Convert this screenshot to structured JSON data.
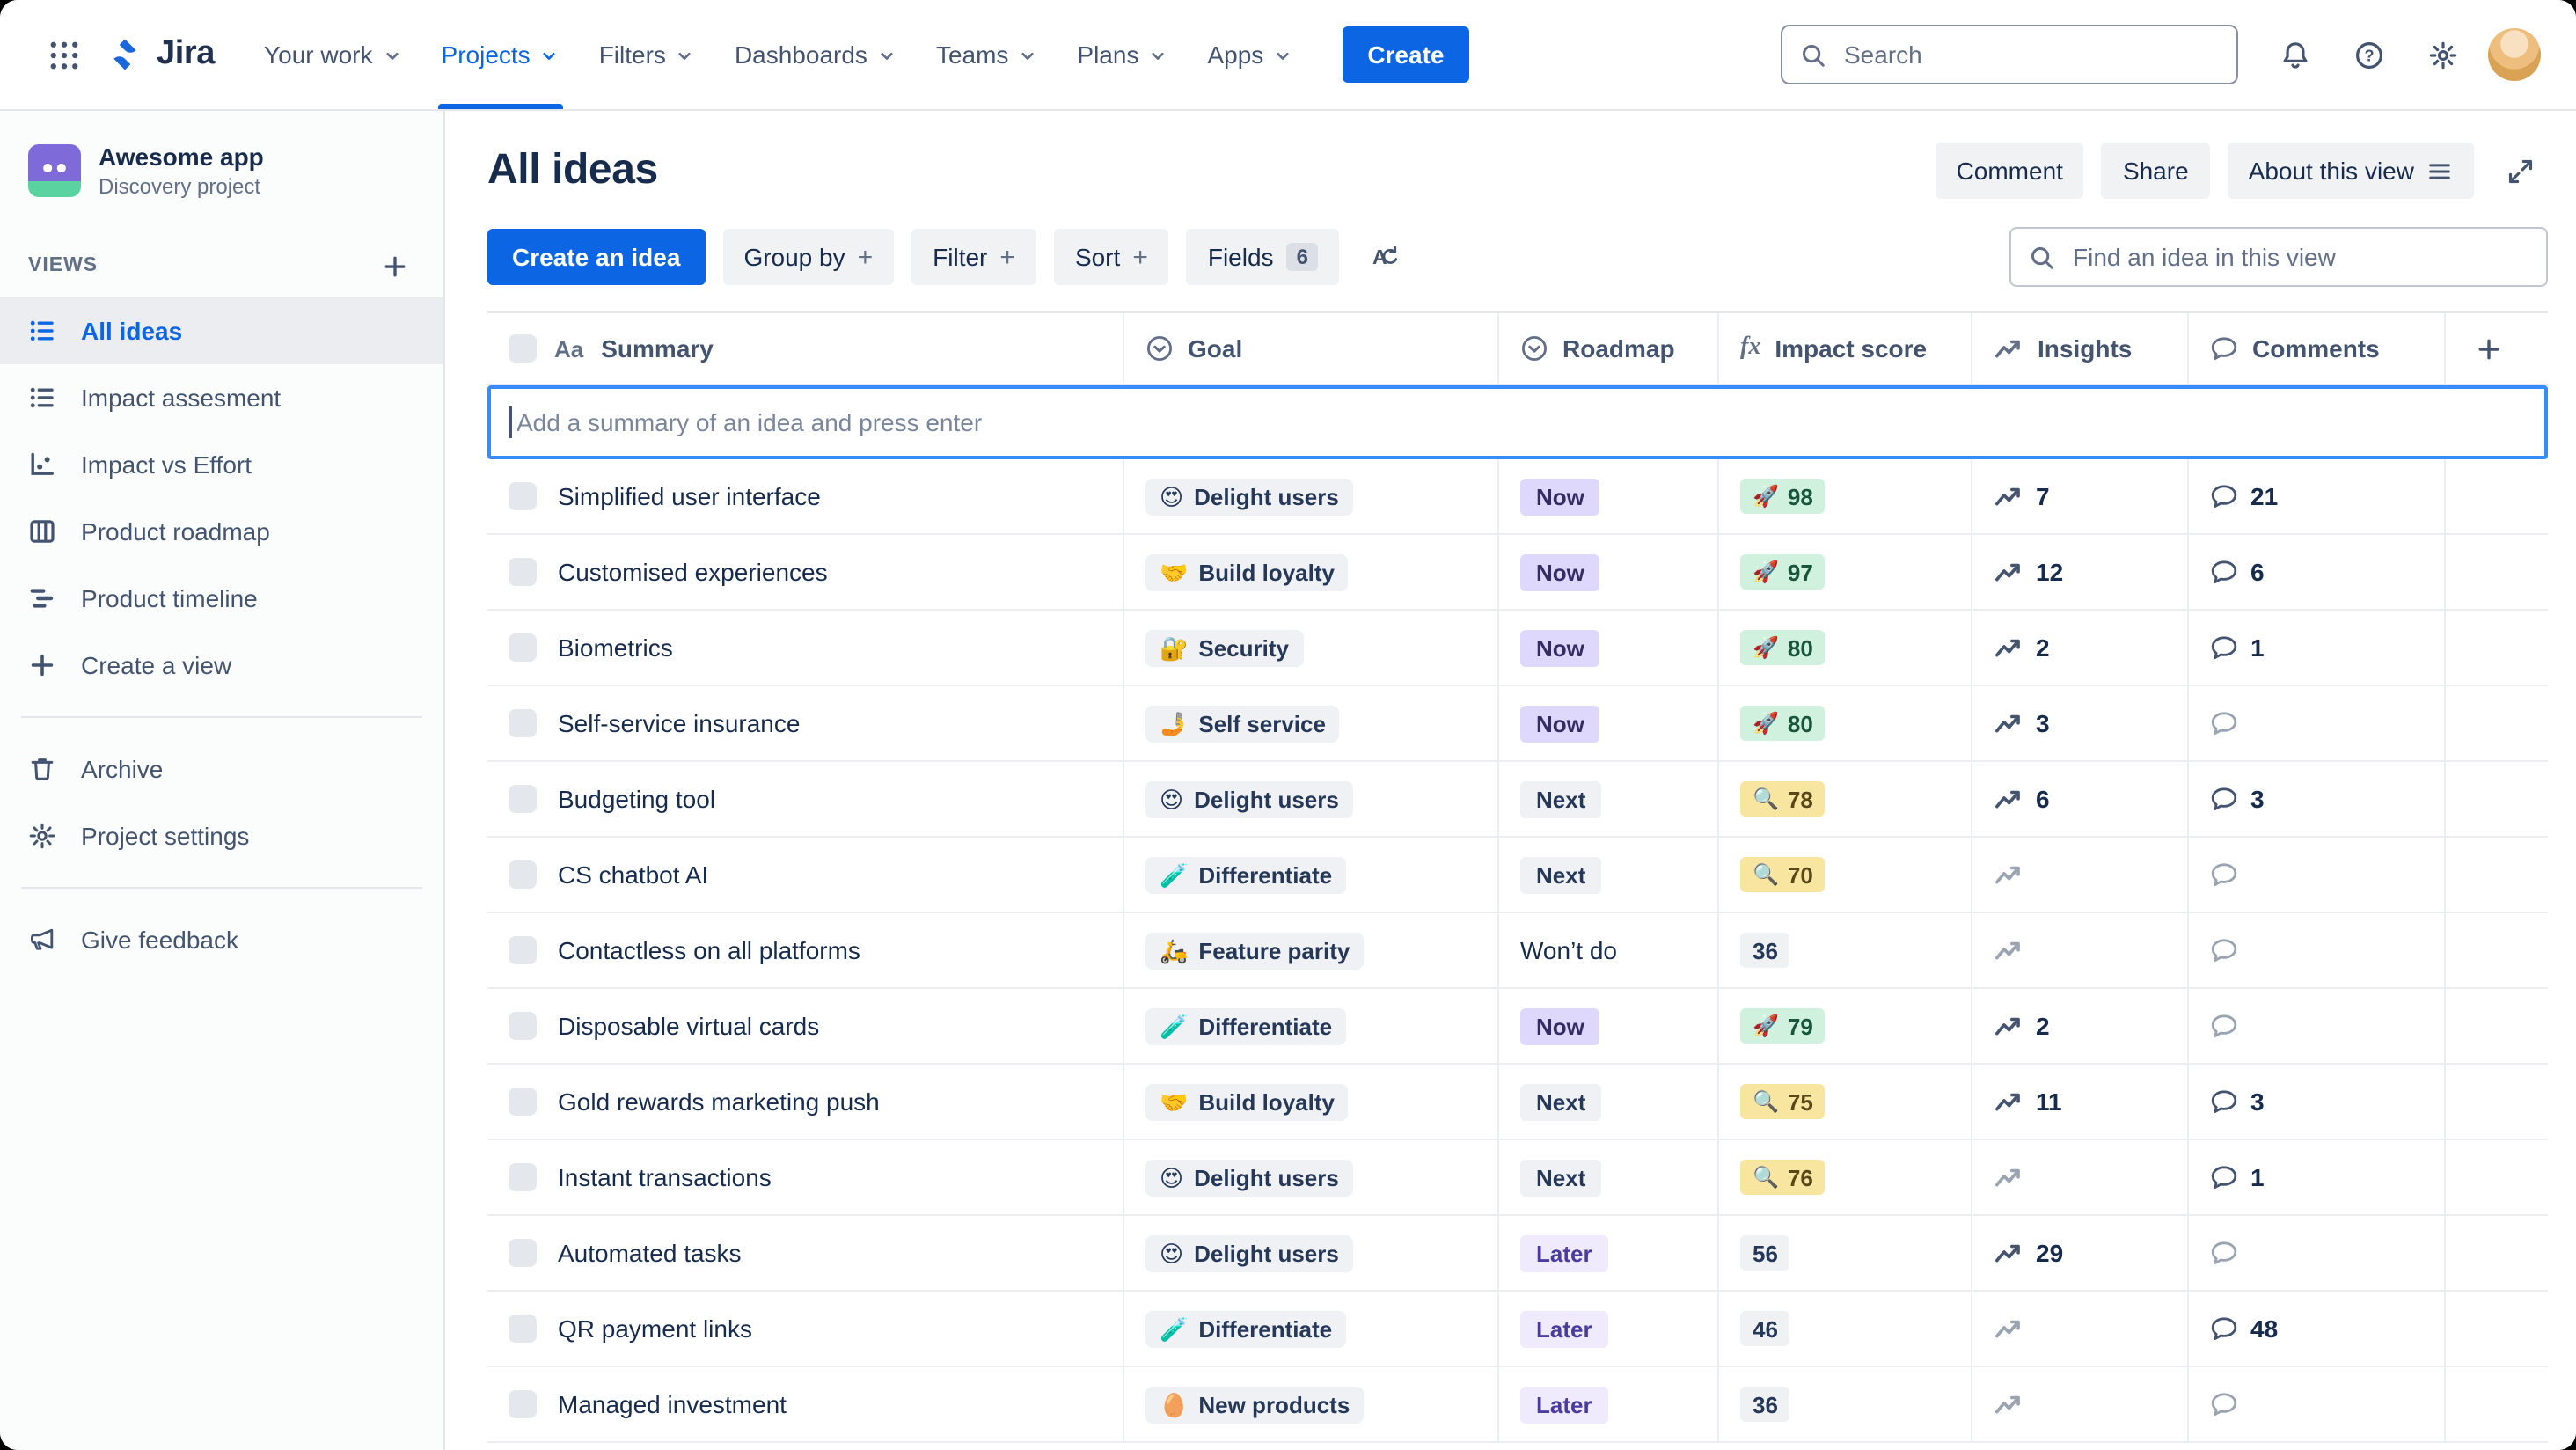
{
  "topnav": {
    "brand": "Jira",
    "items": [
      {
        "label": "Your work",
        "active": false
      },
      {
        "label": "Projects",
        "active": true
      },
      {
        "label": "Filters",
        "active": false
      },
      {
        "label": "Dashboards",
        "active": false
      },
      {
        "label": "Teams",
        "active": false
      },
      {
        "label": "Plans",
        "active": false
      },
      {
        "label": "Apps",
        "active": false
      }
    ],
    "create_label": "Create",
    "search_placeholder": "Search"
  },
  "sidebar": {
    "project_name": "Awesome app",
    "project_type": "Discovery project",
    "views_label": "VIEWS",
    "views": [
      {
        "label": "All ideas",
        "icon": "list",
        "selected": true
      },
      {
        "label": "Impact assesment",
        "icon": "list",
        "selected": false
      },
      {
        "label": "Impact vs Effort",
        "icon": "scatter",
        "selected": false
      },
      {
        "label": "Product roadmap",
        "icon": "board",
        "selected": false
      },
      {
        "label": "Product timeline",
        "icon": "timeline",
        "selected": false
      },
      {
        "label": "Create a view",
        "icon": "plus",
        "selected": false
      }
    ],
    "tools": [
      {
        "label": "Archive",
        "icon": "trash"
      },
      {
        "label": "Project settings",
        "icon": "gear"
      }
    ],
    "feedback_label": "Give feedback"
  },
  "page": {
    "title": "All ideas",
    "comment_label": "Comment",
    "share_label": "Share",
    "about_label": "About this view"
  },
  "toolbar": {
    "create_idea_label": "Create an idea",
    "group_by_label": "Group by",
    "filter_label": "Filter",
    "sort_label": "Sort",
    "fields_label": "Fields",
    "fields_count": "6",
    "find_placeholder": "Find an idea in this view"
  },
  "table": {
    "summary_icon": "Aa",
    "fx_icon": "fx",
    "columns": [
      "Summary",
      "Goal",
      "Roadmap",
      "Impact score",
      "Insights",
      "Comments"
    ],
    "add_placeholder": "Add a summary of an idea and press enter",
    "rows": [
      {
        "summary": "Simplified user interface",
        "goal_emoji": "😍",
        "goal": "Delight users",
        "stage": "Now",
        "stage_color": "purple",
        "score": "98",
        "score_emoji": "🚀",
        "score_color": "green",
        "insights": "7",
        "comments": "21"
      },
      {
        "summary": "Customised experiences",
        "goal_emoji": "🤝",
        "goal": "Build loyalty",
        "stage": "Now",
        "stage_color": "purple",
        "score": "97",
        "score_emoji": "🚀",
        "score_color": "green",
        "insights": "12",
        "comments": "6"
      },
      {
        "summary": "Biometrics",
        "goal_emoji": "🔐",
        "goal": "Security",
        "stage": "Now",
        "stage_color": "purple",
        "score": "80",
        "score_emoji": "🚀",
        "score_color": "green",
        "insights": "2",
        "comments": "1"
      },
      {
        "summary": "Self-service insurance",
        "goal_emoji": "🤳",
        "goal": "Self service",
        "stage": "Now",
        "stage_color": "purple",
        "score": "80",
        "score_emoji": "🚀",
        "score_color": "green",
        "insights": "3",
        "comments": ""
      },
      {
        "summary": "Budgeting tool",
        "goal_emoji": "😍",
        "goal": "Delight users",
        "stage": "Next",
        "stage_color": "gray",
        "score": "78",
        "score_emoji": "🔍",
        "score_color": "yellow",
        "insights": "6",
        "comments": "3"
      },
      {
        "summary": "CS chatbot AI",
        "goal_emoji": "🧪",
        "goal": "Differentiate",
        "stage": "Next",
        "stage_color": "gray",
        "score": "70",
        "score_emoji": "🔍",
        "score_color": "yellow",
        "insights": "",
        "comments": ""
      },
      {
        "summary": "Contactless on all platforms",
        "goal_emoji": "🛵",
        "goal": "Feature parity",
        "stage": "Won’t do",
        "stage_color": "none",
        "score": "36",
        "score_emoji": "",
        "score_color": "gray",
        "insights": "",
        "comments": ""
      },
      {
        "summary": "Disposable virtual cards",
        "goal_emoji": "🧪",
        "goal": "Differentiate",
        "stage": "Now",
        "stage_color": "purple",
        "score": "79",
        "score_emoji": "🚀",
        "score_color": "green",
        "insights": "2",
        "comments": ""
      },
      {
        "summary": "Gold rewards marketing push",
        "goal_emoji": "🤝",
        "goal": "Build loyalty",
        "stage": "Next",
        "stage_color": "gray",
        "score": "75",
        "score_emoji": "🔍",
        "score_color": "yellow",
        "insights": "11",
        "comments": "3"
      },
      {
        "summary": "Instant transactions",
        "goal_emoji": "😍",
        "goal": "Delight users",
        "stage": "Next",
        "stage_color": "gray",
        "score": "76",
        "score_emoji": "🔍",
        "score_color": "yellow",
        "insights": "",
        "comments": "1"
      },
      {
        "summary": "Automated tasks",
        "goal_emoji": "😍",
        "goal": "Delight users",
        "stage": "Later",
        "stage_color": "lavender",
        "score": "56",
        "score_emoji": "",
        "score_color": "gray",
        "insights": "29",
        "comments": ""
      },
      {
        "summary": "QR payment links",
        "goal_emoji": "🧪",
        "goal": "Differentiate",
        "stage": "Later",
        "stage_color": "lavender",
        "score": "46",
        "score_emoji": "",
        "score_color": "gray",
        "insights": "",
        "comments": "48"
      },
      {
        "summary": "Managed investment",
        "goal_emoji": "🥚",
        "goal": "New products",
        "stage": "Later",
        "stage_color": "lavender",
        "score": "36",
        "score_emoji": "",
        "score_color": "gray",
        "insights": "",
        "comments": ""
      }
    ]
  }
}
